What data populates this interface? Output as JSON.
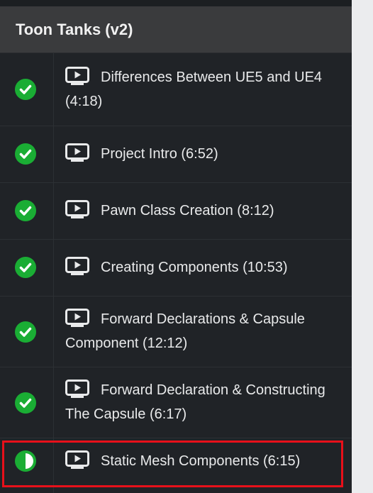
{
  "section": {
    "title": "Toon Tanks (v2)"
  },
  "lectures": [
    {
      "title": "Differences Between UE5 and UE4 (4:18)",
      "status": "complete",
      "status_icon": "check-circle-icon",
      "type_icon": "video-play-icon"
    },
    {
      "title": "Project Intro (6:52)",
      "status": "complete",
      "status_icon": "check-circle-icon",
      "type_icon": "video-play-icon"
    },
    {
      "title": "Pawn Class Creation (8:12)",
      "status": "complete",
      "status_icon": "check-circle-icon",
      "type_icon": "video-play-icon"
    },
    {
      "title": "Creating Components (10:53)",
      "status": "complete",
      "status_icon": "check-circle-icon",
      "type_icon": "video-play-icon"
    },
    {
      "title": "Forward Declarations & Capsule Component (12:12)",
      "status": "complete",
      "status_icon": "check-circle-icon",
      "type_icon": "video-play-icon"
    },
    {
      "title": "Forward Declaration & Constructing The Capsule (6:17)",
      "status": "complete",
      "status_icon": "check-circle-icon",
      "type_icon": "video-play-icon"
    },
    {
      "title": "Static Mesh Components (6:15)",
      "status": "in-progress",
      "status_icon": "half-circle-icon",
      "type_icon": "video-play-icon"
    }
  ],
  "colors": {
    "complete_green": "#1aad34",
    "highlight_red": "#e8101a",
    "panel_bg": "#202327",
    "header_bg": "#3a3b3d"
  }
}
